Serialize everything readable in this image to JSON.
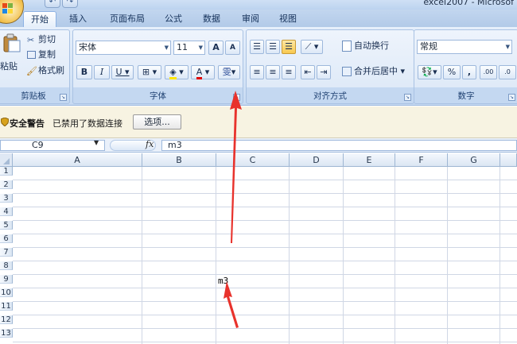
{
  "window": {
    "title": "excel2007 - Microsof"
  },
  "tabs": [
    {
      "label": "开始",
      "active": true
    },
    {
      "label": "插入"
    },
    {
      "label": "页面布局"
    },
    {
      "label": "公式"
    },
    {
      "label": "数据"
    },
    {
      "label": "审阅"
    },
    {
      "label": "视图"
    }
  ],
  "ribbon": {
    "clipboard": {
      "label": "剪贴板",
      "paste_label": "粘贴",
      "cut": "剪切",
      "copy": "复制",
      "format_painter": "格式刷"
    },
    "font": {
      "label": "字体",
      "font_name": "宋体",
      "font_size": "11",
      "grow": "A",
      "shrink": "A",
      "bold": "B",
      "italic": "I",
      "underline": "U",
      "font_color_glyph": "A",
      "phonetic_glyph": "雯"
    },
    "alignment": {
      "label": "对齐方式",
      "wrap_text": "自动换行",
      "merge_center": "合并后居中"
    },
    "number": {
      "label": "数字",
      "format": "常规",
      "percent": "%",
      "comma": ",",
      "inc_decimal": ".00",
      "dec_decimal": ".0"
    }
  },
  "security_bar": {
    "title": "安全警告",
    "message": "已禁用了数据连接",
    "button": "选项..."
  },
  "formula_bar": {
    "name_box": "C9",
    "fx": "fx",
    "value": "m3"
  },
  "sheet": {
    "columns": [
      "A",
      "B",
      "C",
      "D",
      "E",
      "F",
      "G"
    ],
    "rows": [
      "1",
      "2",
      "3",
      "4",
      "5",
      "6",
      "7",
      "8",
      "9",
      "10",
      "11",
      "12",
      "13"
    ],
    "cell_c9": "m3"
  },
  "colors": {
    "ribbon": "#dfeaf8",
    "annotation_arrow": "#e8322c"
  }
}
